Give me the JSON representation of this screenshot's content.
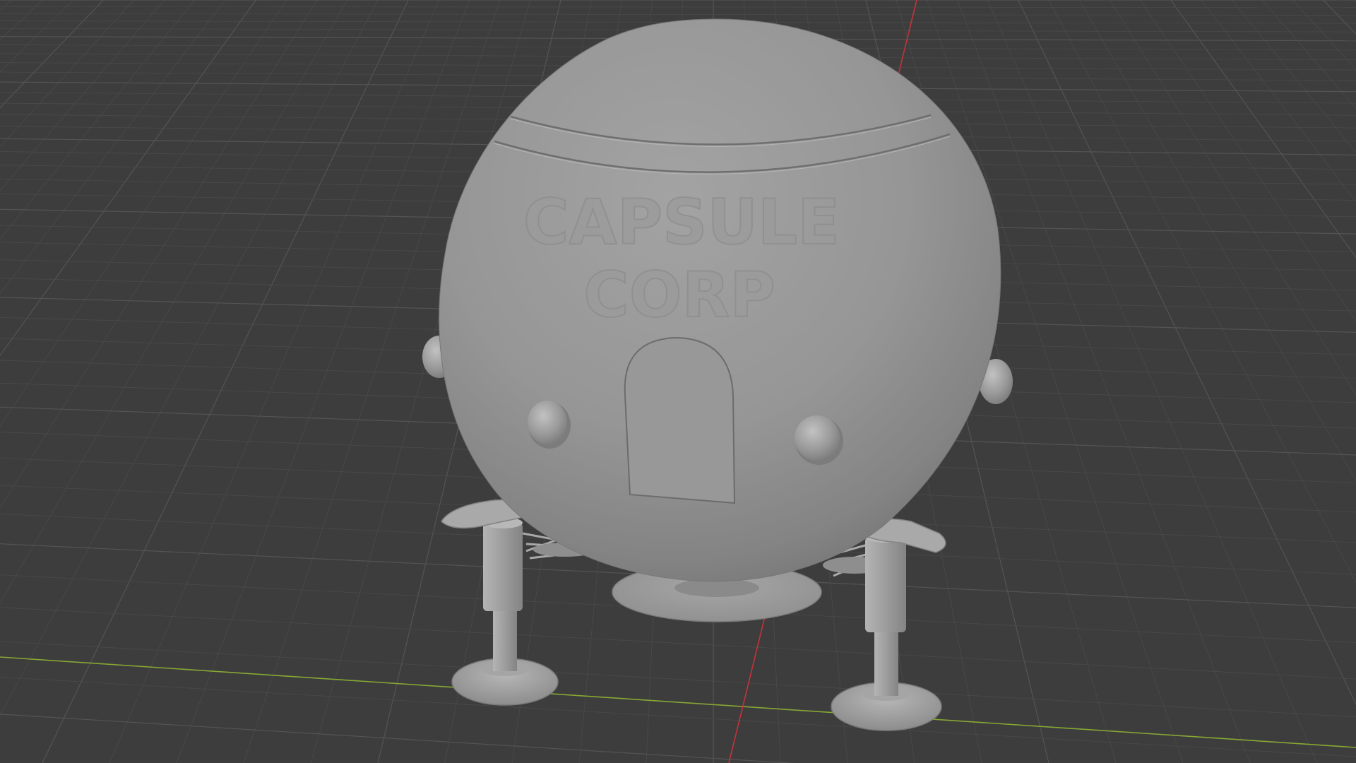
{
  "viewport": {
    "mode": "solid-shading",
    "background_color": "#3d3d3d",
    "grid_line_color": "#4a4a4a",
    "grid_major_color": "#545454",
    "x_axis_color": "#c6323b",
    "y_axis_color": "#86a834",
    "model_color": "#9a9a9a"
  },
  "model": {
    "name": "capsule-ship",
    "parts": [
      "dome-shell",
      "top-hatch-ring",
      "door",
      "porthole-left",
      "porthole-right",
      "side-knob-left",
      "side-knob-right",
      "landing-leg-left",
      "landing-leg-right",
      "base-thruster-plate",
      "strut-cluster"
    ],
    "embossed_text": [
      "CAPSULE",
      "CORP"
    ]
  }
}
